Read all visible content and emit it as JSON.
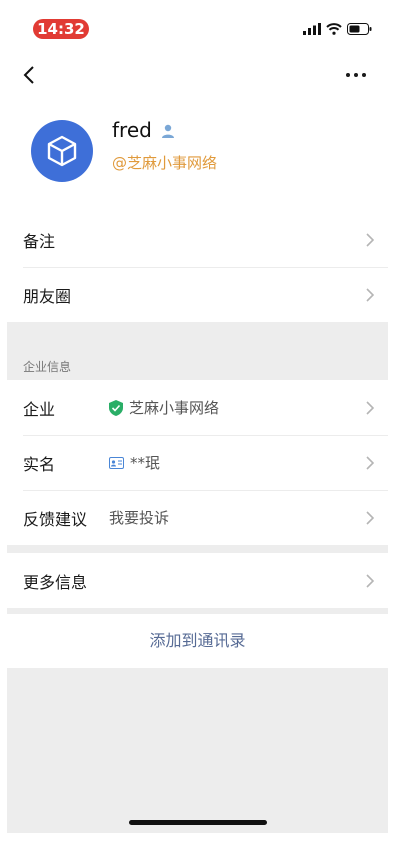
{
  "status_bar": {
    "time": "14:32"
  },
  "profile": {
    "name": "fred",
    "handle": "@芝麻小事网络"
  },
  "rows_top": [
    {
      "label": "备注"
    },
    {
      "label": "朋友圈"
    }
  ],
  "section_enterprise": {
    "header": "企业信息",
    "company_label": "企业",
    "company_value": "芝麻小事网络",
    "realname_label": "实名",
    "realname_value": "**珉",
    "feedback_label": "反馈建议",
    "feedback_value": "我要投诉"
  },
  "more_info": {
    "label": "更多信息"
  },
  "action": {
    "add_contact_label": "添加到通讯录"
  },
  "colors": {
    "accent_link": "#576b95",
    "handle": "#e09a3c",
    "time_pill": "#e13b34",
    "avatar": "#3e6fd8"
  }
}
